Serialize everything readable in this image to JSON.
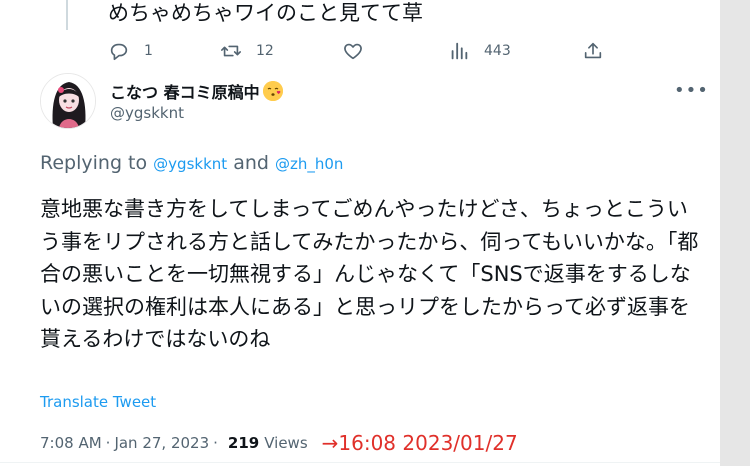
{
  "previous_tweet": {
    "text": "めちゃめちゃワイのこと見てて草",
    "actions": {
      "reply_count": "1",
      "retweet_count": "12",
      "like_count": "",
      "views_count": "443"
    }
  },
  "tweet": {
    "author": {
      "display_name": "こなつ 春コミ原稿中",
      "handle": "@ygskknt"
    },
    "replying": {
      "prefix": "Replying to",
      "user1": "@ygskknt",
      "conjunction": "and",
      "user2": "@zh_h0n"
    },
    "body": "意地悪な書き方をしてしまってごめんやったけどさ、ちょっとこういう事をリプされる方と話してみたかったから、伺ってもいいかな。「都合の悪いことを一切無視する」んじゃなくて「SNSで返事をするしないの選択の権利は本人にある」と思っリプをしたからって必ず返事を貰えるわけではないのね",
    "translate_label": "Translate Tweet",
    "meta": {
      "time": "7:08 AM",
      "separator": "·",
      "date": "Jan 27, 2023",
      "separator2": "·",
      "views_count": "219",
      "views_label": "Views"
    },
    "annotation": "→16:08  2023/01/27"
  },
  "colors": {
    "link": "#1d9bf0",
    "secondary_text": "#536471",
    "annotation": "#e0302a"
  }
}
